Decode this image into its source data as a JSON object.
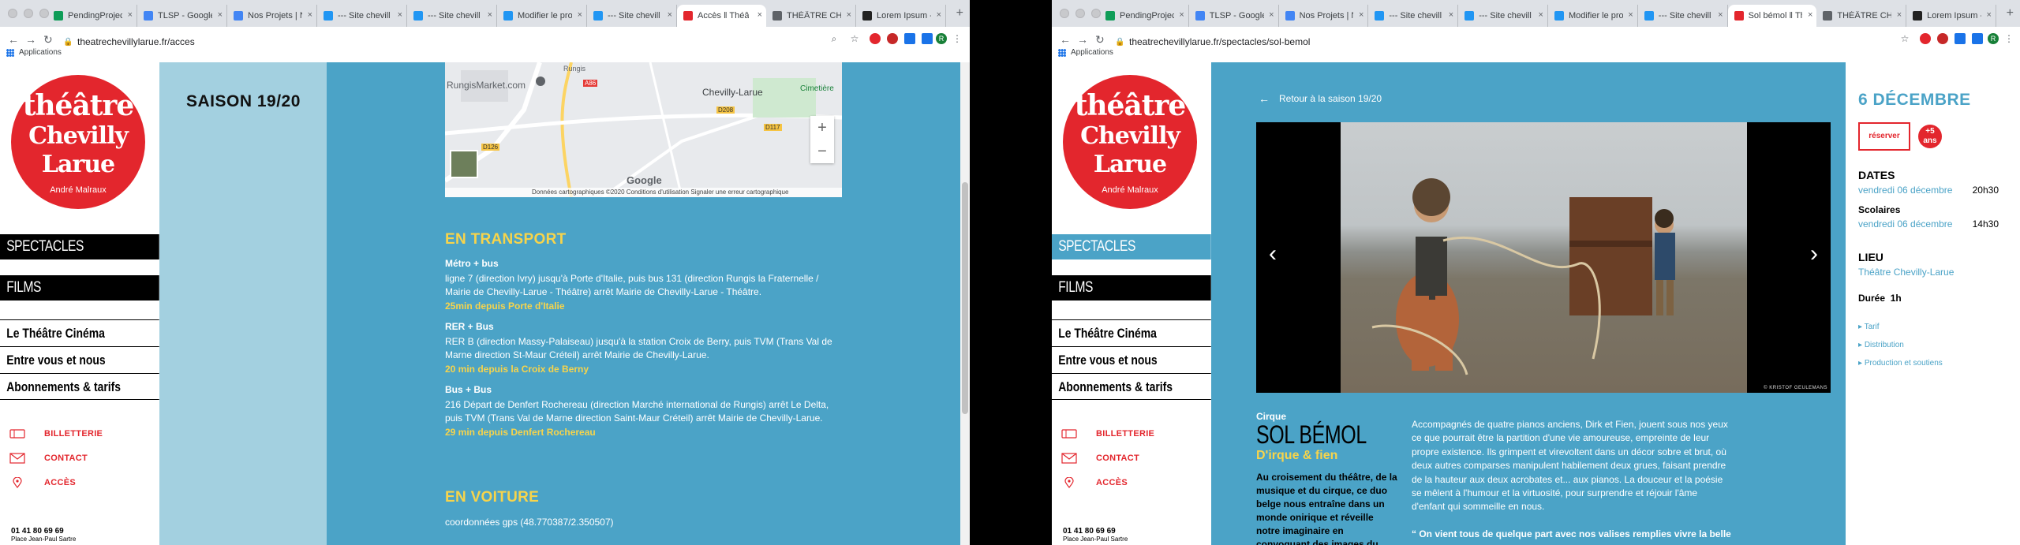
{
  "left_window": {
    "tabs": [
      {
        "title": "PendingProjects",
        "color": "#0f9d58"
      },
      {
        "title": "TLSP - Google",
        "color": "#4285f4"
      },
      {
        "title": "Nos Projets | N",
        "color": "#4285f4"
      },
      {
        "title": "--- Site chevill",
        "color": "#2196f3"
      },
      {
        "title": "--- Site chevill",
        "color": "#2196f3"
      },
      {
        "title": "Modifier le proj",
        "color": "#2196f3"
      },
      {
        "title": "--- Site chevill",
        "color": "#2196f3"
      },
      {
        "title": "Accès ‖ Théâ",
        "color": "#e3262d",
        "active": true
      },
      {
        "title": "THÉÂTRE CHE",
        "color": "#5f6368"
      },
      {
        "title": "Lorem Ipsum -",
        "color": "#222"
      }
    ],
    "url": "theatrechevillylarue.fr/acces",
    "apps_label": "Applications",
    "saison_title": "SAISON 19/20",
    "map": {
      "labels": [
        "RungisMarket.com",
        "Chevilly-Larue",
        "Cimetière",
        "A86",
        "D126",
        "D117",
        "D208",
        "Rungis"
      ],
      "google": "Google",
      "credit": "Données cartographiques ©2020   Conditions d'utilisation   Signaler une erreur cartographique",
      "zoom_in": "+",
      "zoom_out": "−"
    },
    "transport": {
      "title": "EN TRANSPORT",
      "items": [
        {
          "head": "Métro + bus",
          "text": "ligne 7 (direction Ivry) jusqu'à Porte d'Italie, puis bus 131 (direction Rungis la Fraternelle / Mairie de Chevilly-Larue - Théâtre) arrêt Mairie de Chevilly-Larue - Théâtre.",
          "duration": "25min depuis Porte d'Italie"
        },
        {
          "head": "RER + Bus",
          "text": "RER B (direction Massy-Palaiseau) jusqu'à la station Croix de Berry, puis TVM (Trans Val de Marne direction St-Maur Créteil) arrêt Mairie de Chevilly-Larue.",
          "duration": "20 min depuis la Croix de Berny"
        },
        {
          "head": "Bus + Bus",
          "text": "216 Départ de Denfert Rochereau (direction Marché international de Rungis) arrêt Le Delta, puis TVM (Trans Val de Marne direction Saint-Maur Créteil) arrêt Mairie de Chevilly-Larue.",
          "duration": "29 min depuis Denfert Rochereau"
        }
      ]
    },
    "voiture": {
      "title": "EN VOITURE",
      "text": "coordonnées gps (48.770387/2.350507)"
    }
  },
  "right_window": {
    "tabs": [
      {
        "title": "PendingProjects",
        "color": "#0f9d58"
      },
      {
        "title": "TLSP - Google",
        "color": "#4285f4"
      },
      {
        "title": "Nos Projets | N",
        "color": "#4285f4"
      },
      {
        "title": "--- Site chevill",
        "color": "#2196f3"
      },
      {
        "title": "--- Site chevill",
        "color": "#2196f3"
      },
      {
        "title": "Modifier le proj",
        "color": "#2196f3"
      },
      {
        "title": "--- Site chevill",
        "color": "#2196f3"
      },
      {
        "title": "Sol bémol ‖ Th",
        "color": "#e3262d",
        "active": true
      },
      {
        "title": "THÉÂTRE CHE",
        "color": "#5f6368"
      },
      {
        "title": "Lorem Ipsum -",
        "color": "#222"
      }
    ],
    "url": "theatrechevillylarue.fr/spectacles/sol-bemol",
    "apps_label": "Applications",
    "back_link": "Retour à la saison 19/20",
    "photo_credit": "© KRISTOF GEULEMANS",
    "category": "Cirque",
    "title": "SOL BÉMOL",
    "subtitle": "D'irque & fien",
    "hook": "Au croisement du théâtre, de la musique et du cirque, ce duo belge nous entraîne dans un monde onirique et réveille notre imaginaire en convoquant des images du cinéma muet.",
    "description": "Accompagnés de quatre pianos anciens, Dirk et Fien, jouent sous nos yeux ce que pourrait être la partition d'une vie amoureuse, empreinte de leur propre existence. Ils grimpent et virevoltent dans un décor sobre et brut, où deux autres comparses manipulent habilement deux grues, faisant prendre de la hauteur aux deux acrobates et... aux pianos. La douceur et la poésie se mêlent à l'humour et la virtuosité, pour surprendre et réjouir l'âme d'enfant qui sommeille en nous.",
    "quote": "“ On vient tous de quelque part avec nos valises remplies vivre la belle",
    "info": {
      "date_head": "6 DÉCEMBRE",
      "reserve": "réserver",
      "age": "+5 ans",
      "dates_label": "DATES",
      "date1": "vendredi 06 décembre",
      "time1": "20h30",
      "scolaires_label": "Scolaires",
      "date2": "vendredi 06 décembre",
      "time2": "14h30",
      "lieu_label": "LIEU",
      "lieu": "Théâtre Chevilly-Larue",
      "duree_label": "Durée",
      "duree": "1h",
      "links": [
        "Tarif",
        "Distribution",
        "Production et soutiens"
      ]
    }
  },
  "site": {
    "logo": {
      "l1": "théâtre",
      "l2": "Chevilly",
      "l3": "Larue",
      "l4": "André Malraux"
    },
    "main_nav": [
      "SPECTACLES",
      "FILMS"
    ],
    "sub_nav": [
      "Le Théâtre Cinéma",
      "Entre vous et nous",
      "Abonnements & tarifs"
    ],
    "util": [
      "BILLETTERIE",
      "CONTACT",
      "ACCÈS"
    ],
    "phone": "01 41 80 69 69",
    "address": "Place Jean-Paul Sartre"
  }
}
